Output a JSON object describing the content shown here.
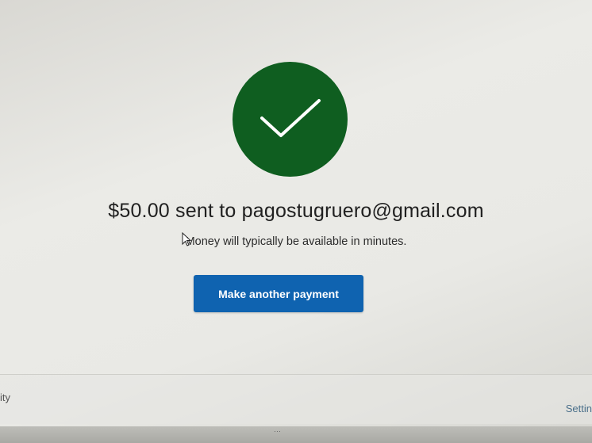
{
  "confirmation": {
    "title": "$50.00 sent to pagostugruero@gmail.com",
    "subtitle": "Money will typically be available in minutes.",
    "button_label": "Make another payment",
    "icon": "checkmark-icon"
  },
  "footer": {
    "left_text": "ity",
    "right_text": "Settin"
  },
  "colors": {
    "success_green": "#0f5e20",
    "button_blue": "#0f63b0"
  }
}
